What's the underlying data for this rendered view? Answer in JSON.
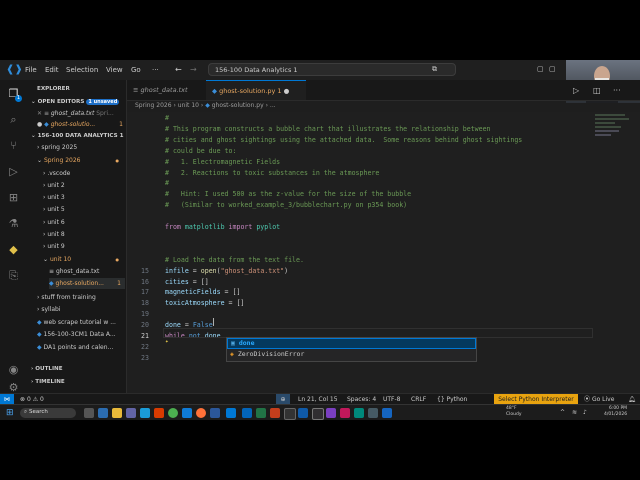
{
  "menu": [
    "File",
    "Edit",
    "Selection",
    "View",
    "Go",
    "···"
  ],
  "command_center": "156-100 Data Analytics 1",
  "webcam_label": "Tako Kirili",
  "sidebar": {
    "title": "EXPLORER",
    "open_editors": "OPEN EDITORS",
    "unsaved_badge": "1 unsaved",
    "open_files": [
      {
        "name": "ghost_data.txt",
        "hint": "Spri..."
      },
      {
        "name": "ghost-solutio...",
        "badge": "1"
      }
    ],
    "workspace": "156-100 DATA ANALYTICS 1",
    "tree": [
      {
        "label": "spring 2025",
        "indent": 1
      },
      {
        "label": "Spring 2026",
        "indent": 1,
        "color": "orange",
        "dot": true
      },
      {
        "label": ".vscode",
        "indent": 2
      },
      {
        "label": "unit 2",
        "indent": 2
      },
      {
        "label": "unit 3",
        "indent": 2
      },
      {
        "label": "unit 5",
        "indent": 2
      },
      {
        "label": "unit 6",
        "indent": 2
      },
      {
        "label": "unit 8",
        "indent": 2
      },
      {
        "label": "unit 9",
        "indent": 2
      },
      {
        "label": "unit 10",
        "indent": 2,
        "color": "orange",
        "dot": true
      },
      {
        "label": "ghost_data.txt",
        "indent": 3
      },
      {
        "label": "ghost-solution...",
        "indent": 3,
        "color": "orange",
        "badge": "1"
      },
      {
        "label": "stuff from training",
        "indent": 1
      },
      {
        "label": "syllabi",
        "indent": 1
      },
      {
        "label": "web scrape tutorial w ...",
        "indent": 1
      },
      {
        "label": "156-100-3CM1 Data A...",
        "indent": 1
      },
      {
        "label": "DA1 points and calen...",
        "indent": 1
      }
    ],
    "outline": "OUTLINE",
    "timeline": "TIMELINE"
  },
  "tabs": [
    {
      "label": "ghost_data.txt",
      "active": false
    },
    {
      "label": "ghost-solution.py 1",
      "active": true
    }
  ],
  "breadcrumb": [
    "Spring 2026",
    "unit 10",
    "ghost-solution.py",
    "..."
  ],
  "code_lines": [
    {
      "n": "",
      "segs": [
        {
          "t": "#",
          "c": "cm"
        }
      ]
    },
    {
      "n": "",
      "segs": [
        {
          "t": "# This program constructs a bubble chart that illustrates the relationship between",
          "c": "cm"
        }
      ]
    },
    {
      "n": "",
      "segs": [
        {
          "t": "# cities and ghost sightings using the attached data.  Some reasons behind ghost sightings",
          "c": "cm"
        }
      ]
    },
    {
      "n": "",
      "segs": [
        {
          "t": "# could be due to:",
          "c": "cm"
        }
      ]
    },
    {
      "n": "",
      "segs": [
        {
          "t": "#   1. Electromagnetic Fields",
          "c": "cm"
        }
      ]
    },
    {
      "n": "",
      "segs": [
        {
          "t": "#   2. Reactions to toxic substances in the atmosphere",
          "c": "cm"
        }
      ]
    },
    {
      "n": "",
      "segs": [
        {
          "t": "#",
          "c": "cm"
        }
      ]
    },
    {
      "n": "",
      "segs": [
        {
          "t": "#   Hint: I used 500 as the z-value for the size of the bubble",
          "c": "cm"
        }
      ]
    },
    {
      "n": "",
      "segs": [
        {
          "t": "#   (Similar to worked_example_3/bubblechart.py on p354 book)",
          "c": "cm"
        }
      ]
    },
    {
      "n": "",
      "segs": []
    },
    {
      "n": "",
      "segs": [
        {
          "t": "from ",
          "c": "kw2"
        },
        {
          "t": "matplotlib ",
          "c": "id"
        },
        {
          "t": "import ",
          "c": "kw2"
        },
        {
          "t": "pyplot",
          "c": "id"
        }
      ]
    },
    {
      "n": "",
      "segs": []
    },
    {
      "n": "",
      "segs": []
    },
    {
      "n": "",
      "segs": [
        {
          "t": "# Load the data from the text file.",
          "c": "cm"
        }
      ]
    },
    {
      "n": "15",
      "segs": [
        {
          "t": "infile",
          "c": "var"
        },
        {
          "t": " = "
        },
        {
          "t": "open",
          "c": "fn"
        },
        {
          "t": "("
        },
        {
          "t": "\"ghost_data.txt\"",
          "c": "str"
        },
        {
          "t": ")"
        }
      ]
    },
    {
      "n": "16",
      "segs": [
        {
          "t": "cities",
          "c": "var"
        },
        {
          "t": " = []"
        }
      ]
    },
    {
      "n": "17",
      "segs": [
        {
          "t": "magneticFields",
          "c": "var"
        },
        {
          "t": " = []"
        }
      ]
    },
    {
      "n": "18",
      "segs": [
        {
          "t": "toxicAtmosphere",
          "c": "var"
        },
        {
          "t": " = []"
        }
      ]
    },
    {
      "n": "19",
      "segs": []
    },
    {
      "n": "20",
      "segs": [
        {
          "t": "done",
          "c": "var"
        },
        {
          "t": " = "
        },
        {
          "t": "False",
          "c": "kw"
        }
      ]
    },
    {
      "n": "21",
      "segs": [
        {
          "t": "while ",
          "c": "kw2"
        },
        {
          "t": "not ",
          "c": "kw"
        },
        {
          "t": "done",
          "c": "var"
        }
      ]
    },
    {
      "n": "22",
      "segs": []
    },
    {
      "n": "23",
      "segs": []
    }
  ],
  "suggestions": [
    "done",
    "ZeroDivisionError"
  ],
  "status": {
    "errors": "0",
    "warnings": "0",
    "position": "Ln 21, Col 15",
    "spaces": "Spaces: 4",
    "encoding": "UTF-8",
    "eol": "CRLF",
    "language": "Python",
    "interpreter": "Select Python Interpreter",
    "golive": "Go Live"
  },
  "taskbar": {
    "search": "Search",
    "weather_temp": "48°F",
    "weather_desc": "Cloudy",
    "time": "6:00 PM",
    "date": "4/01/2026"
  },
  "colors": {
    "accent": "#0078d4",
    "interpreter_bg": "#e8a30f",
    "modified": "#e8a861"
  }
}
